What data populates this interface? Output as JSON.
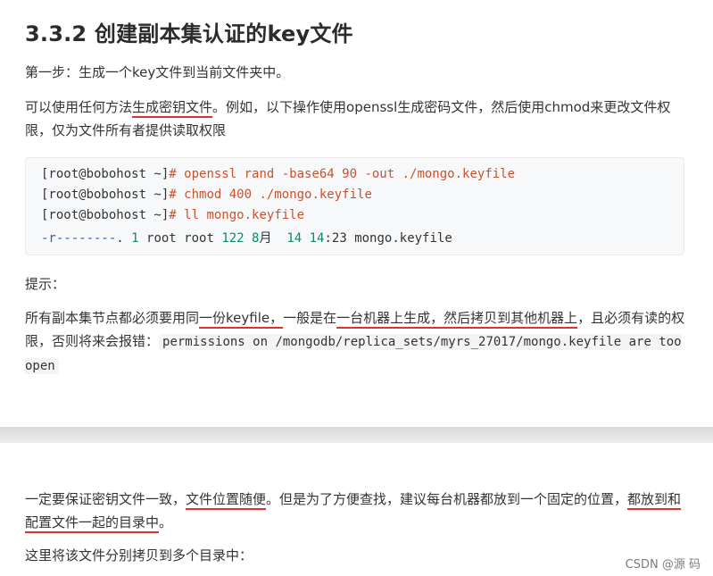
{
  "heading": "3.3.2 创建副本集认证的key文件",
  "step1": "第一步：生成一个key文件到当前文件夹中。",
  "para1": {
    "before": "可以使用任何方法",
    "underlined": "生成密钥文件",
    "after": "。例如，以下操作使用openssl生成密码文件，然后使用chmod来更改文件权限，仅为文件所有者提供读取权限"
  },
  "code": {
    "line1_prompt": "[root@bobohost ~]",
    "line1_hash": "#",
    "line1_cmd": " openssl rand -base64 90 -out ./mongo.keyfile",
    "line2_prompt": "[root@bobohost ~]",
    "line2_hash": "#",
    "line2_cmd": " chmod 400 ./mongo.keyfile",
    "line3_prompt": "[root@bobohost ~]",
    "line3_hash": "#",
    "line3_cmd": " ll mongo.keyfile",
    "line4_perm": "-r--------",
    "line4_dot": ". ",
    "line4_n1": "1",
    "line4_mid": " root root ",
    "line4_n2": "122",
    "line4_n3": " 8",
    "line4_month": "月  ",
    "line4_n4": "14",
    "line4_sp": " ",
    "line4_n5": "14",
    "line4_rest": ":23 mongo.keyfile"
  },
  "tip_label": "提示：",
  "para2": {
    "t1": "所有副本集节点都必须要用同",
    "u1": "一份keyfile，",
    "t2": "一般是在",
    "u2": "一台机器上生成，然后拷贝到其他机器上",
    "t3": "，且必须有读的权限，否则将来会报错：",
    "code": "permissions on /mongodb/replica_sets/myrs_27017/mongo.keyfile are too open"
  },
  "para3": {
    "t1": "一定要保证密钥文件一致，",
    "u1": "文件位置随便",
    "t2": "。但是为了方便查找，建议每台机器都放到一个固定的位置，",
    "u2": "都放到和配置文件一起的目录中",
    "t3": "。"
  },
  "para4": "这里将该文件分别拷贝到多个目录中：",
  "watermark": "CSDN @源  码"
}
